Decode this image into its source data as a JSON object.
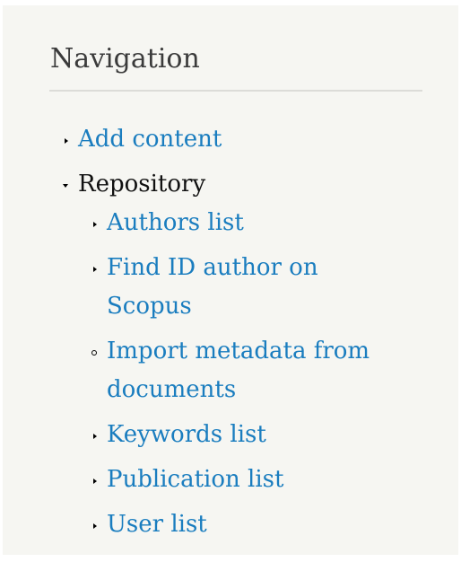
{
  "navigation": {
    "title": "Navigation",
    "items": [
      {
        "label": "Add content"
      },
      {
        "label": "Repository",
        "children": [
          {
            "label": "Authors list"
          },
          {
            "label": "Find ID author on Scopus"
          },
          {
            "label": "Import metadata from documents"
          },
          {
            "label": "Keywords list"
          },
          {
            "label": "Publication list"
          },
          {
            "label": "User list"
          }
        ]
      }
    ]
  },
  "colors": {
    "panel_background": "#f6f6f2",
    "link": "#1a7dbf",
    "heading": "#3b3b3b"
  },
  "icons": {
    "collapsed": "triangle-right-icon",
    "expanded": "triangle-down-icon",
    "leaf": "circle-outline-icon"
  }
}
